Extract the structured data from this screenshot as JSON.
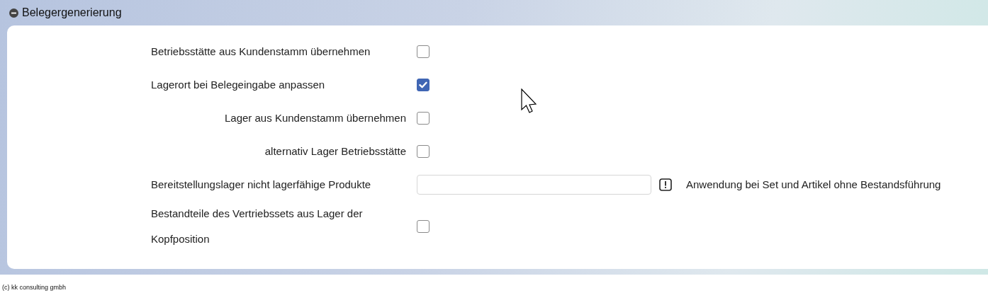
{
  "section": {
    "title": "Belegergenerierung",
    "expanded": true
  },
  "options": [
    {
      "kind": "checkbox",
      "label": "Betriebsstätte aus Kundenstamm übernehmen",
      "sub_option": false,
      "checked": false
    },
    {
      "kind": "checkbox",
      "label": "Lagerort bei Belegeingabe anpassen",
      "sub_option": false,
      "checked": true
    },
    {
      "kind": "checkbox",
      "label": "Lager aus Kundenstamm übernehmen",
      "sub_option": true,
      "checked": false
    },
    {
      "kind": "checkbox",
      "label": "alternativ Lager Betriebsstätte",
      "sub_option": true,
      "checked": false
    },
    {
      "kind": "field",
      "label": "Bereitstellungslager nicht lagerfähige Produkte",
      "sub_option": false,
      "hint": "Anwendung bei Set und Artikel ohne Bestandsführung"
    },
    {
      "kind": "checkbox",
      "label": "Bestandteile des Vertriebssets aus Lager der Kopfposition",
      "sub_option": false,
      "checked": false
    }
  ],
  "footer": "(c) kk consulting gmbh"
}
